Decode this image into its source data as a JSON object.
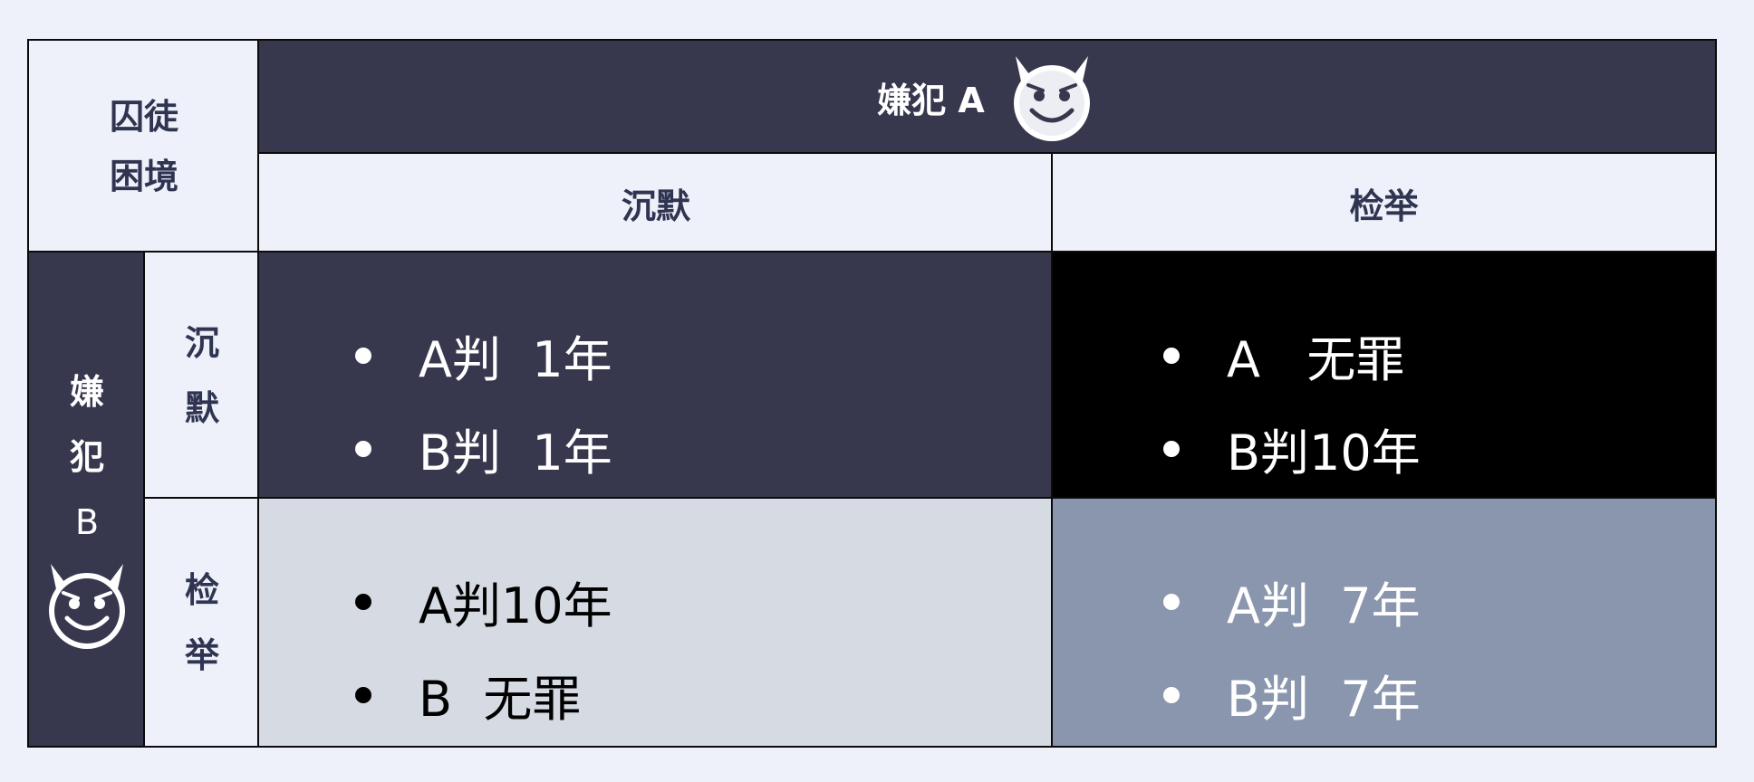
{
  "title": {
    "line1": "囚徒",
    "line2": "困境"
  },
  "player_a": {
    "label": "嫌犯 A",
    "icon": "devil-face-icon"
  },
  "player_b": {
    "chars": [
      "嫌",
      "犯",
      "B"
    ],
    "icon": "devil-face-icon"
  },
  "columns": [
    "沉默",
    "检举"
  ],
  "rows": [
    [
      "沉",
      "默"
    ],
    [
      "检",
      "举"
    ]
  ],
  "payoffs": {
    "silent_silent": [
      "A判  1年",
      "B判  1年"
    ],
    "silent_report": [
      "A   无罪",
      "B判10年"
    ],
    "report_silent": [
      "A判10年",
      "B  无罪"
    ],
    "report_report": [
      "A判  7年",
      "B判  7年"
    ]
  },
  "colors": {
    "background": "#eef0fa",
    "dark": "#37374e",
    "black": "#000000",
    "pale": "#d6dbe3",
    "steel": "#8a96ad",
    "text_dark": "#2f3550"
  }
}
